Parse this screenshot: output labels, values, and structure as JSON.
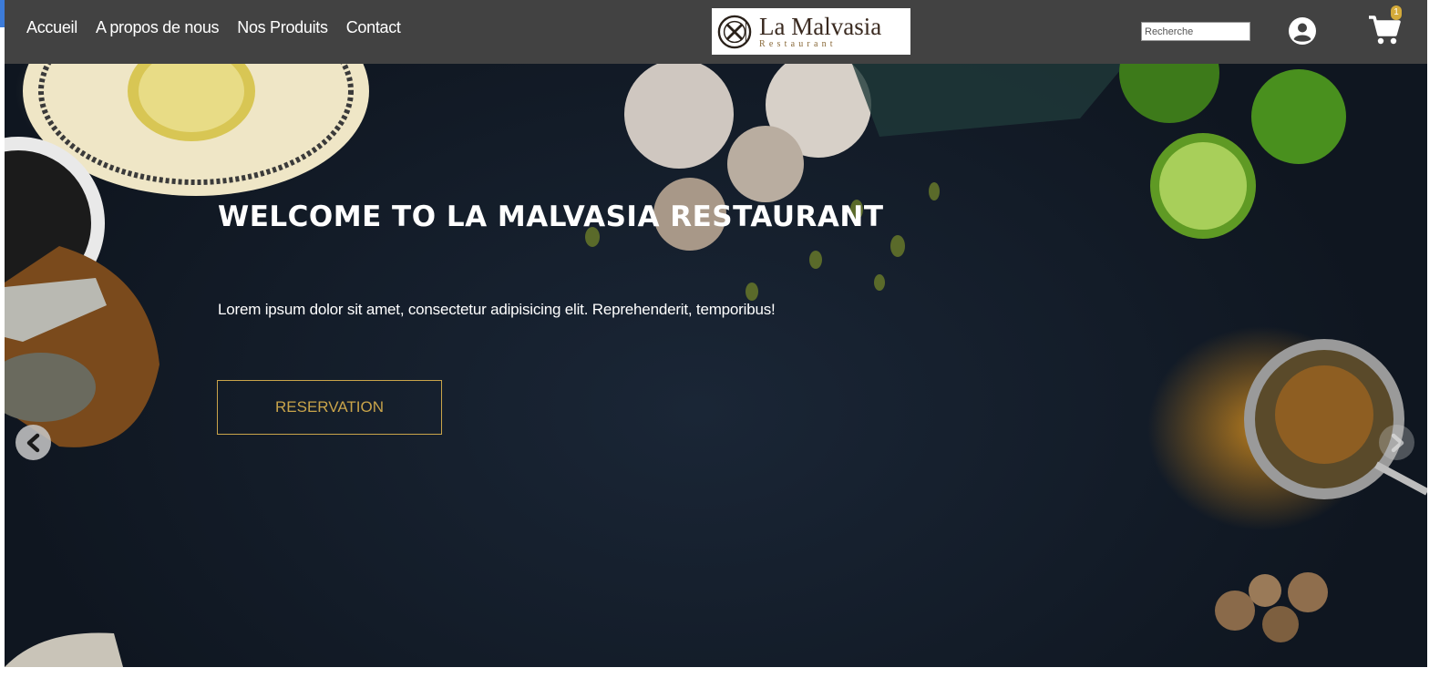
{
  "nav": {
    "links": [
      {
        "label": "Accueil"
      },
      {
        "label": "A propos de nous"
      },
      {
        "label": "Nos Produits"
      },
      {
        "label": "Contact"
      }
    ]
  },
  "logo": {
    "title": "La Malvasia",
    "subtitle": "Restaurant"
  },
  "search": {
    "placeholder": "Recherche"
  },
  "cart": {
    "count": "1"
  },
  "hero": {
    "title": "WELCOME TO LA MALVASIA RESTAURANT",
    "text": "Lorem ipsum dolor sit amet, consectetur adipisicing elit. Reprehenderit, temporibus!",
    "button_label": "RESERVATION"
  },
  "icons": {
    "user": "user-circle-icon",
    "cart": "shopping-cart-icon",
    "prev": "chevron-left-icon",
    "next": "chevron-right-icon"
  },
  "colors": {
    "navbar": "#424242",
    "accent": "#c9a44a",
    "hero_bg": "#111a26"
  }
}
